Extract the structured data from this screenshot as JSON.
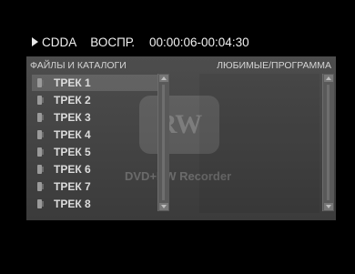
{
  "header": {
    "source": "CDDA",
    "mode": "ВОСПР.",
    "time": "00:00:06-00:04:30"
  },
  "files_column": {
    "title": "ФАЙЛЫ И КАТАЛОГИ",
    "items": [
      {
        "label": "ТРЕК 1",
        "selected": true
      },
      {
        "label": "ТРЕК 2"
      },
      {
        "label": "ТРЕК 3"
      },
      {
        "label": "ТРЕК 4"
      },
      {
        "label": "ТРЕК 5"
      },
      {
        "label": "ТРЕК 6"
      },
      {
        "label": "ТРЕК 7"
      },
      {
        "label": "ТРЕК 8"
      }
    ]
  },
  "favorites_column": {
    "title": "ЛЮБИМЫЕ/ПРОГРАММА",
    "items": []
  },
  "watermark": {
    "logo_text": "RW",
    "caption": "DVD+RW Recorder"
  }
}
